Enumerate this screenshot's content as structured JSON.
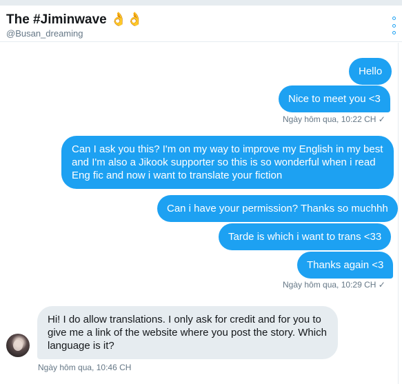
{
  "conversation": {
    "title": "The #Jiminwave 👌👌",
    "handle": "@Busan_dreaming"
  },
  "messages": {
    "m1": "Hello",
    "m2": "Nice to meet you <3",
    "ts1": "Ngày hôm qua, 10:22 CH ✓",
    "m3": "Can I ask you this? I'm on my way to improve my English in my best and I'm also a Jikook supporter so this is so wonderful when i read Eng fic and now i want to translate your fiction",
    "m4": "Can i have your permission? Thanks so muchhh",
    "m5": "Tarde is which i want to trans <33",
    "m6": "Thanks again <3",
    "ts2": "Ngày hôm qua, 10:29 CH ✓",
    "m7": "Hi! I do allow translations. I only ask for credit and for you to give me a link of the website where you post the story. Which language is it?",
    "ts3": "Ngày hôm qua, 10:46 CH"
  },
  "colors": {
    "accent": "#1da1f2",
    "incoming_bubble": "#e6ecf0",
    "meta_text": "#657786"
  },
  "icons": {
    "more": "vertical-dots-icon"
  }
}
